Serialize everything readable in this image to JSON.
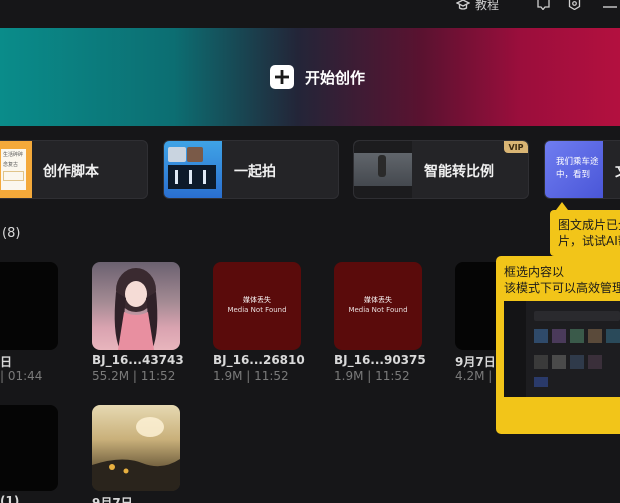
{
  "topbar": {
    "tutorial_label": "教程"
  },
  "banner": {
    "label": "开始创作"
  },
  "tools": [
    {
      "label": "创作脚本",
      "thumb_text_1": "生活碎碎",
      "thumb_text_2": "念复古"
    },
    {
      "label": "一起拍"
    },
    {
      "label": "智能转比例",
      "badge": "VIP"
    },
    {
      "thumb_text_1": "我们乘车途",
      "thumb_text_2": "中，看到",
      "label_partial": "文"
    }
  ],
  "drafts": {
    "count_label": "(8)",
    "missing_cn": "媒体丢失",
    "missing_en": "Media Not Found",
    "row1": [
      {
        "name": "日",
        "meta": "| 01:44"
      },
      {
        "name": "BJ_16...43743",
        "meta": "55.2M | 11:52"
      },
      {
        "name": "BJ_16...26810",
        "meta": "1.9M | 11:52"
      },
      {
        "name": "BJ_16...90375",
        "meta": "1.9M | 11:52"
      },
      {
        "name": "9月7日",
        "meta": "4.2M | 1"
      }
    ],
    "row2": [
      {
        "name": "(1)"
      },
      {
        "name": "9月7日"
      }
    ]
  },
  "tooltips": {
    "ai_tip": {
      "line1": "图文成片已全",
      "line2": "片，试试AI帮"
    },
    "manage_tip": {
      "line1": "框选内容以",
      "line2": "该模式下可以高效管理资"
    }
  },
  "colors": {
    "accent_yellow": "#f2c519",
    "missing_red": "#5a0b0b",
    "vip_gold": "#d9b574"
  }
}
